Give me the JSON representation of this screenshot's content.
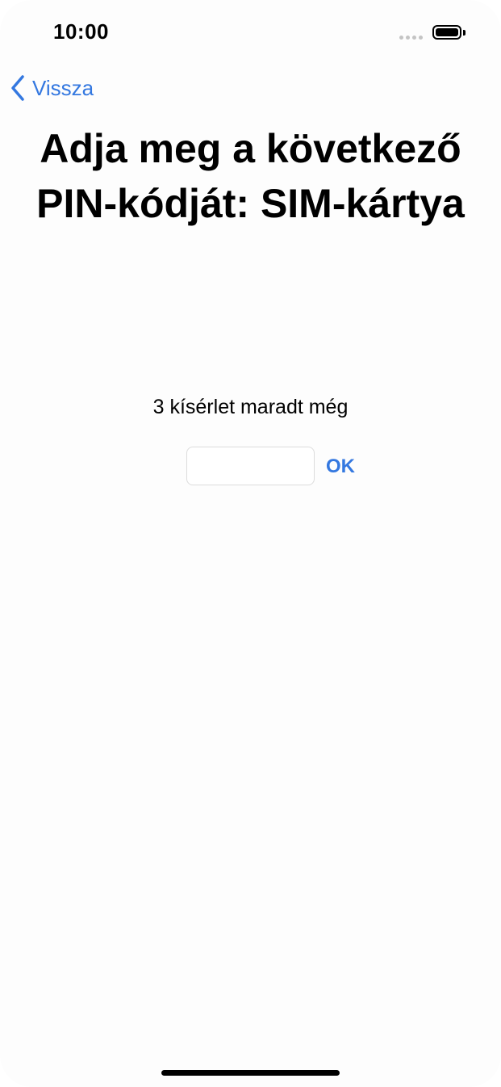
{
  "status_bar": {
    "time": "10:00"
  },
  "nav": {
    "back_label": "Vissza"
  },
  "title": "Adja meg a következő PIN-kódját: SIM-kártya",
  "attempts_text": "3 kísérlet maradt még",
  "pin_field": {
    "value": "",
    "placeholder": ""
  },
  "ok_label": "OK",
  "colors": {
    "accent": "#3478e0",
    "background": "#fdfdfd",
    "text": "#000000"
  },
  "icons": {
    "back": "chevron-left-icon",
    "signal": "signal-dots-icon",
    "battery": "battery-icon"
  }
}
